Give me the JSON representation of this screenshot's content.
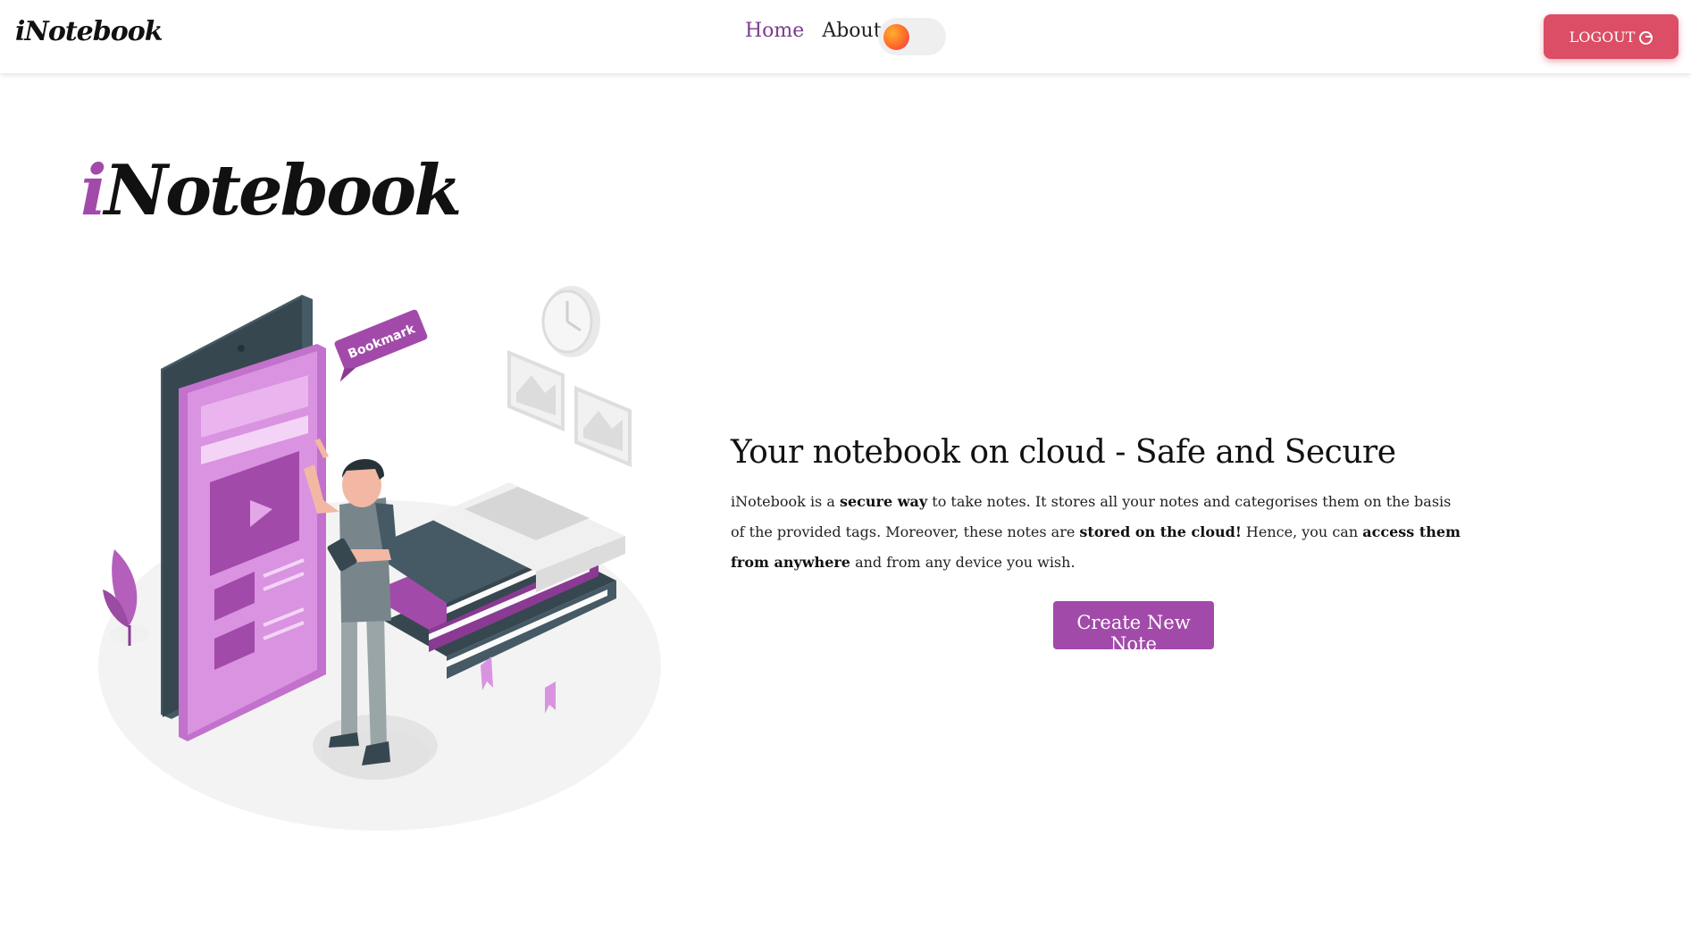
{
  "navbar": {
    "brand": "iNotebook",
    "links": [
      {
        "label": "Home",
        "active": true
      },
      {
        "label": "About",
        "active": false
      }
    ],
    "theme_toggle": "on",
    "logout_label": "LOGOUT"
  },
  "hero": {
    "logo_prefix": "i",
    "logo_rest": "Notebook",
    "illustration": {
      "bookmark_tag": "Bookmark"
    },
    "headline": "Your notebook on cloud - Safe and Secure",
    "description": {
      "p1": "iNotebook is a ",
      "b1": "secure way",
      "p2": " to take notes. It stores all your notes and categorises them on the basis of the provided tags. Moreover, these notes are ",
      "b2": "stored on the cloud!",
      "p3": " Hence, you can ",
      "b3": "access them from anywhere",
      "p4": " and from any device you wish."
    },
    "cta_label": "Create New Note"
  },
  "colors": {
    "accent": "#a24aaa",
    "logout": "#dc4e65",
    "nav_active": "#7b3d8d"
  }
}
